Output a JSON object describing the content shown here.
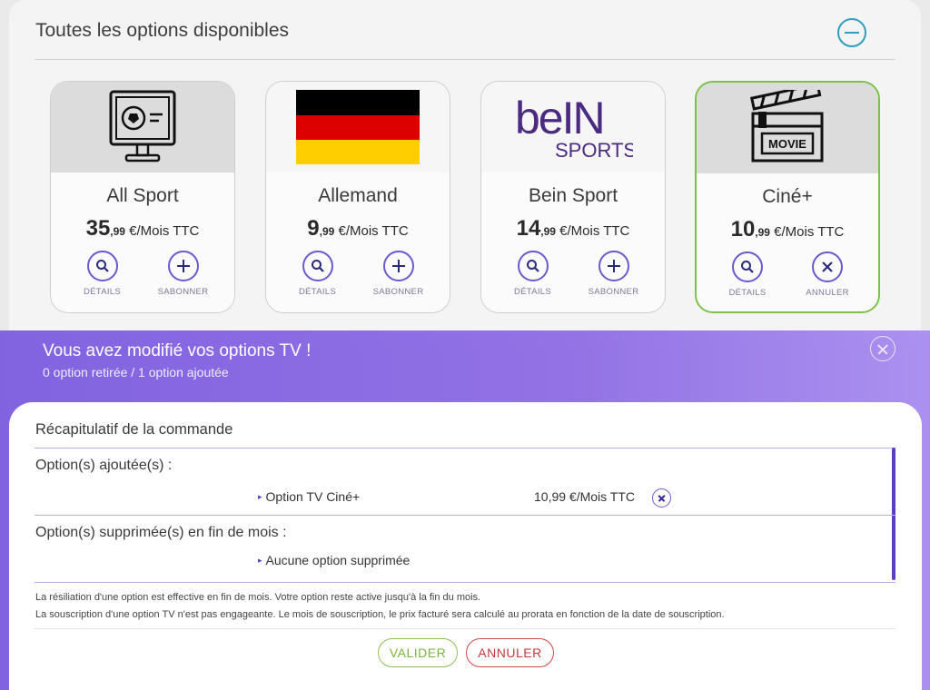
{
  "panel": {
    "title": "Toutes les options disponibles",
    "collapse_icon": "minus-circle-icon"
  },
  "cards": [
    {
      "name": "All Sport",
      "price_int": "35",
      "price_dec": ",99",
      "price_unit": " €/Mois TTC",
      "details_label": "DÉTAILS",
      "action_label": "SABONNER",
      "action_icon": "plus-icon",
      "logo": "sport-monitor-icon",
      "selected": false
    },
    {
      "name": "Allemand",
      "price_int": "9",
      "price_dec": ",99",
      "price_unit": " €/Mois TTC",
      "details_label": "DÉTAILS",
      "action_label": "SABONNER",
      "action_icon": "plus-icon",
      "logo": "germany-flag-icon",
      "selected": false
    },
    {
      "name": "Bein Sport",
      "price_int": "14",
      "price_dec": ",99",
      "price_unit": " €/Mois TTC",
      "details_label": "DÉTAILS",
      "action_label": "SABONNER",
      "action_icon": "plus-icon",
      "logo": "bein-sports-logo",
      "logo_line1": "beIN",
      "logo_line2": "SPORTS",
      "selected": false
    },
    {
      "name": "Ciné+",
      "price_int": "10",
      "price_dec": ",99",
      "price_unit": " €/Mois TTC",
      "details_label": "DÉTAILS",
      "action_label": "ANNULER",
      "action_icon": "close-icon",
      "logo": "movie-clapperboard-icon",
      "logo_text": "MOVIE",
      "selected": true
    }
  ],
  "band": {
    "title": "Vous avez modifié vos options TV !",
    "subtitle": "0 option retirée / 1 option ajoutée",
    "close_icon": "close-circle-icon"
  },
  "summary": {
    "title": "Récapitulatif de la commande",
    "added_label": "Option(s) ajoutée(s) :",
    "added_item": "Option TV Ciné+",
    "added_price": "10,99 €/Mois TTC",
    "removed_label": "Option(s) supprimée(s) en fin de mois :",
    "removed_item": "Aucune option supprimée",
    "note1": "La résiliation d'une option est effective en fin de mois. Votre option reste active jusqu'à la fin du mois.",
    "note2": "La souscription d'une option TV n'est pas engageante. Le mois de souscription, le prix facturé sera calculé au prorata en fonction de la date de souscription.",
    "validate_label": "VALIDER",
    "cancel_label": "ANNULER"
  },
  "colors": {
    "accent": "#6a5acd",
    "band": "#8f6ee4",
    "validate": "#7ab540",
    "cancel": "#c53b3b",
    "selected_border": "#7cc24a"
  }
}
